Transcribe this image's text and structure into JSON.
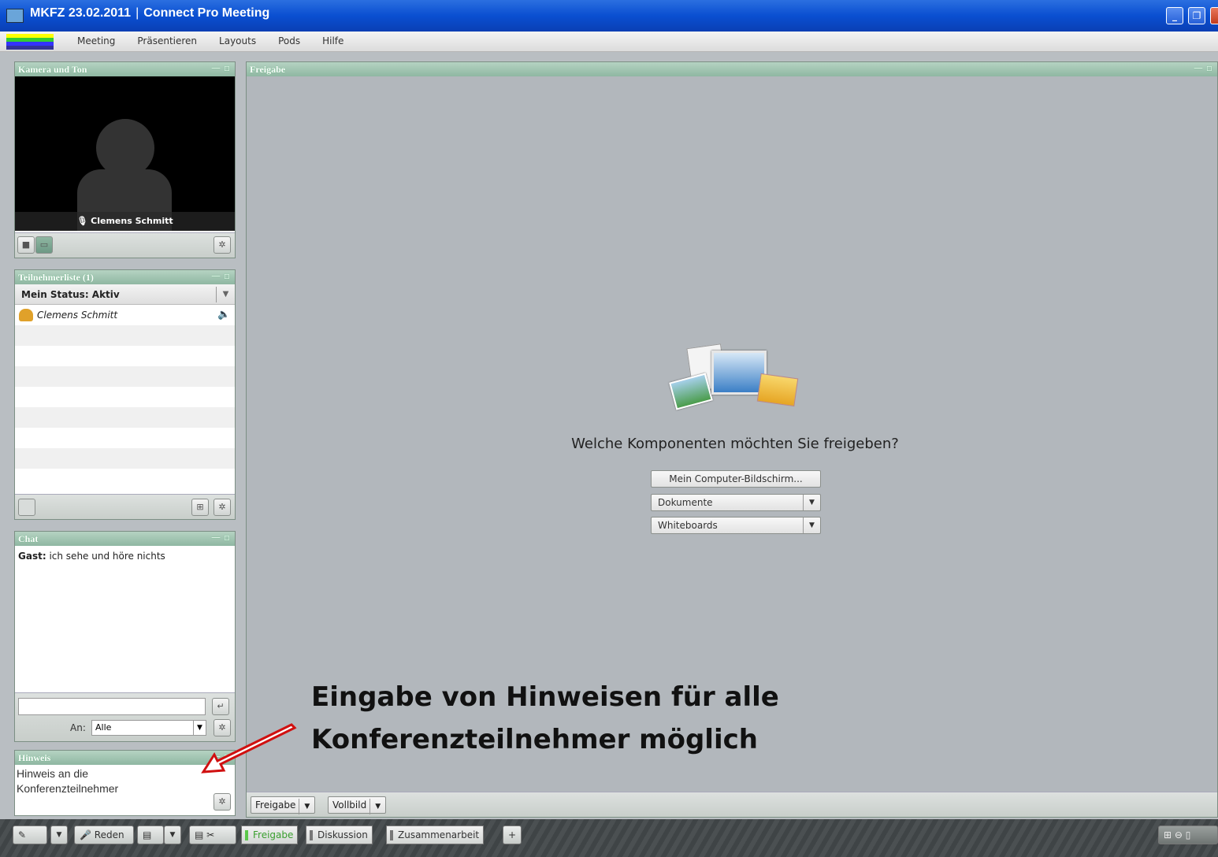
{
  "window": {
    "title": "MKFZ 23.02.2011",
    "app_name": "Connect Pro Meeting",
    "separator": "|"
  },
  "menu": {
    "items": [
      "Meeting",
      "Präsentieren",
      "Layouts",
      "Pods",
      "Hilfe"
    ]
  },
  "camera_pod": {
    "title": "Kamera und Ton",
    "user_name": "Clemens Schmitt"
  },
  "attendee_pod": {
    "title": "Teilnehmerliste (1)",
    "my_status": "Mein Status: Aktiv",
    "attendees": [
      {
        "name": "Clemens Schmitt"
      }
    ]
  },
  "chat_pod": {
    "title": "Chat",
    "messages": [
      {
        "sender": "Gast:",
        "text": "ich sehe und höre nichts"
      }
    ],
    "input_value": "",
    "to_label": "An:",
    "to_value": "Alle"
  },
  "note_pod": {
    "title": "Hinweis",
    "text": "Hinweis an die Konferenzteilnehmer"
  },
  "share_pod": {
    "title": "Freigabe",
    "question": "Welche Komponenten möchten Sie freigeben?",
    "buttons": {
      "screen": "Mein Computer-Bildschirm...",
      "documents": "Dokumente",
      "whiteboards": "Whiteboards"
    },
    "footer": {
      "share": "Freigabe",
      "fullscreen": "Vollbild"
    }
  },
  "annotation": {
    "line1": "Eingabe von Hinweisen für alle",
    "line2": "Konferenzteilnehmer möglich"
  },
  "layout_bar": {
    "talk_button": "Reden",
    "tabs": [
      "Freigabe",
      "Diskussion",
      "Zusammenarbeit"
    ],
    "add": "+"
  },
  "colors": {
    "titlebar": "#0a4fd1",
    "pod_header": "#8fb7a2",
    "workspace": "#b9bec2",
    "active_tab": "#5cc84b",
    "arrow": "#d01010"
  }
}
